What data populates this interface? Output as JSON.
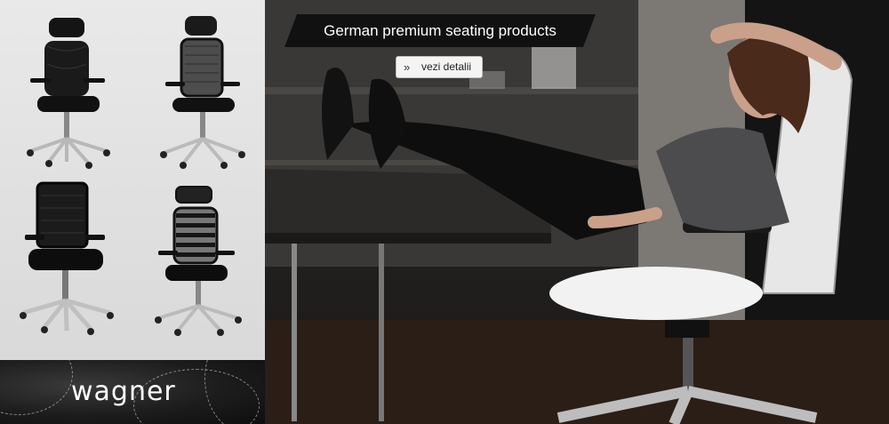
{
  "headline": "German premium seating products",
  "details_button": "vezi detalii",
  "logo": "wagner",
  "products": [
    {
      "name": "leather executive chair with headrest"
    },
    {
      "name": "mesh executive chair with headrest"
    },
    {
      "name": "black mesh office chair"
    },
    {
      "name": "black striped chair with headrest"
    }
  ],
  "colors": {
    "headline_bg": "#111111",
    "headline_text": "#ffffff",
    "button_bg": "#f4f4f4"
  }
}
